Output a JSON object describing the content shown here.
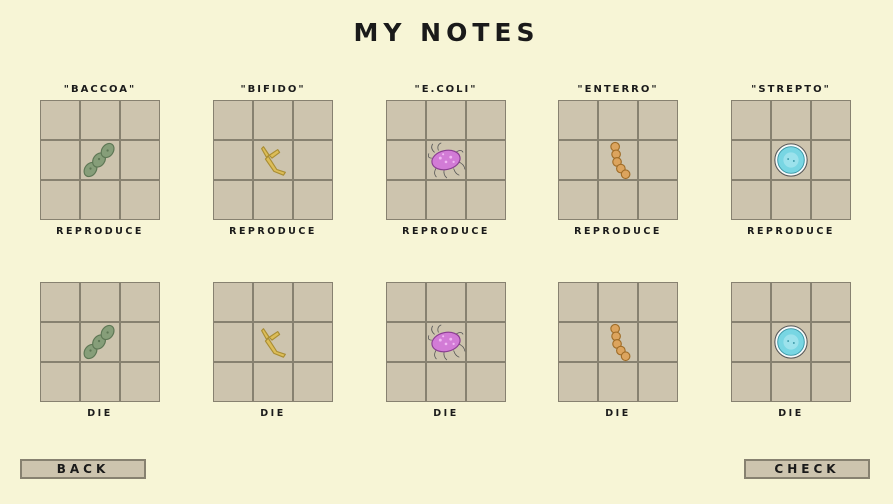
{
  "title": "MY NOTES",
  "bacteria": [
    {
      "name": "\"BACCOA\"",
      "icon": "green-chain-bacterium-icon"
    },
    {
      "name": "\"BIFIDO\"",
      "icon": "yellow-branched-bacterium-icon"
    },
    {
      "name": "\"E.COLI\"",
      "icon": "pink-flagellated-bacterium-icon"
    },
    {
      "name": "\"ENTERRO\"",
      "icon": "orange-chain-bacterium-icon"
    },
    {
      "name": "\"STREPTO\"",
      "icon": "blue-round-bacterium-icon"
    }
  ],
  "rows": [
    {
      "label": "REPRODUCE"
    },
    {
      "label": "DIE"
    }
  ],
  "buttons": {
    "back": "BACK",
    "check": "CHECK"
  },
  "colors": {
    "background": "#f7f5d6",
    "cell": "#cdc4ae",
    "grid_line": "#878170",
    "baccoa": "#7f9a72",
    "bifido": "#dcbd58",
    "ecoli": "#d27bd6",
    "enterro": "#dca45e",
    "strepto": "#78d6e3"
  }
}
